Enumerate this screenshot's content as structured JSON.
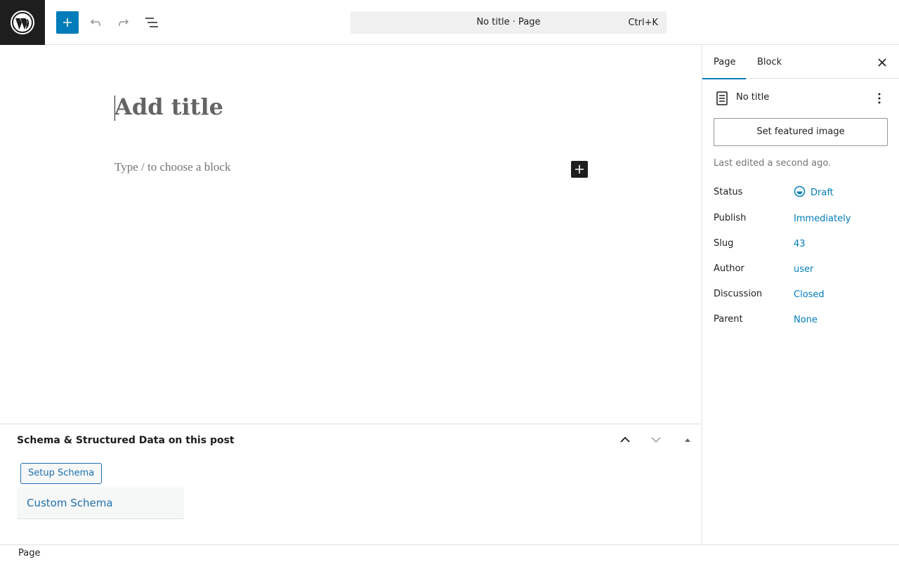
{
  "topbar": {
    "document_title": "No title · Page",
    "shortcut": "Ctrl+K"
  },
  "editor": {
    "title_placeholder": "Add title",
    "block_placeholder": "Type / to choose a block"
  },
  "metabox": {
    "title": "Schema & Structured Data on this post",
    "setup_button": "Setup Schema",
    "custom_schema_label": "Custom Schema"
  },
  "footer": {
    "breadcrumb": "Page"
  },
  "sidebar": {
    "tabs": [
      {
        "label": "Page",
        "active": true
      },
      {
        "label": "Block",
        "active": false
      }
    ],
    "doc_title": "No title",
    "featured_image_button": "Set featured image",
    "last_edited": "Last edited a second ago.",
    "meta": [
      {
        "label": "Status",
        "value": "Draft"
      },
      {
        "label": "Publish",
        "value": "Immediately"
      },
      {
        "label": "Slug",
        "value": "43"
      },
      {
        "label": "Author",
        "value": "user"
      },
      {
        "label": "Discussion",
        "value": "Closed"
      },
      {
        "label": "Parent",
        "value": "None"
      }
    ]
  },
  "colors": {
    "accent": "#007cba",
    "dark": "#1e1e1e",
    "link": "#2271b1"
  }
}
